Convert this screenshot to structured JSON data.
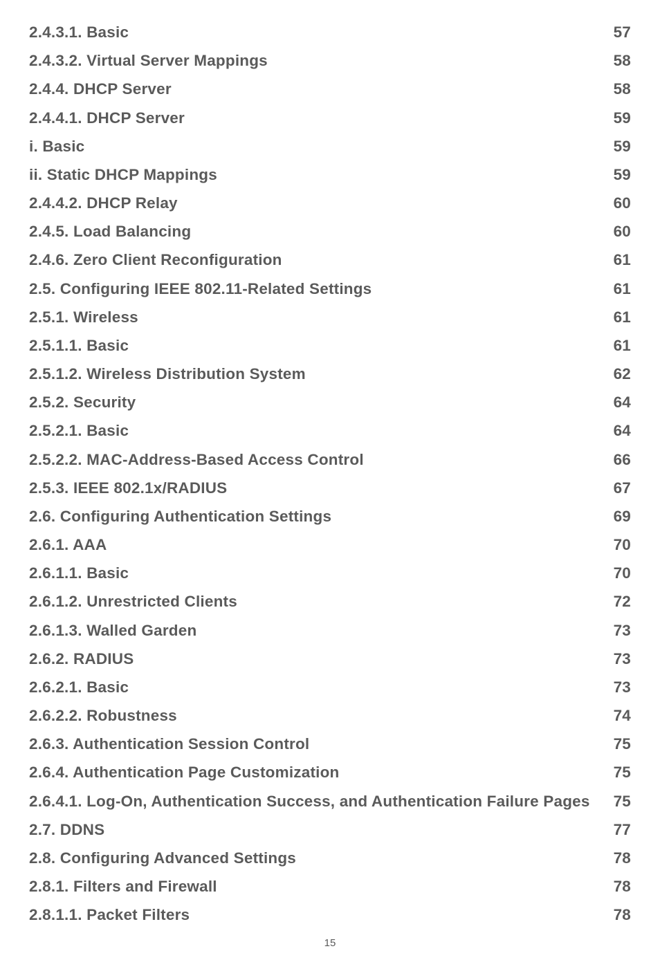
{
  "toc": [
    {
      "title": "2.4.3.1. Basic",
      "page": "57"
    },
    {
      "title": "2.4.3.2. Virtual Server Mappings",
      "page": "58"
    },
    {
      "title": "2.4.4. DHCP Server",
      "page": "58"
    },
    {
      "title": "2.4.4.1. DHCP Server",
      "page": "59"
    },
    {
      "title": "i.  Basic",
      "page": "59"
    },
    {
      "title": "ii. Static DHCP Mappings",
      "page": "59"
    },
    {
      "title": "2.4.4.2. DHCP Relay",
      "page": "60"
    },
    {
      "title": "2.4.5. Load Balancing",
      "page": "60"
    },
    {
      "title": "2.4.6. Zero Client Reconfiguration",
      "page": "61"
    },
    {
      "title": "2.5. Configuring IEEE 802.11-Related Settings",
      "page": "61"
    },
    {
      "title": "2.5.1. Wireless",
      "page": "61"
    },
    {
      "title": "2.5.1.1. Basic",
      "page": "61"
    },
    {
      "title": "2.5.1.2. Wireless Distribution System",
      "page": "62"
    },
    {
      "title": "2.5.2. Security",
      "page": "64"
    },
    {
      "title": "2.5.2.1. Basic",
      "page": "64"
    },
    {
      "title": "2.5.2.2. MAC-Address-Based Access Control",
      "page": "66"
    },
    {
      "title": "2.5.3. IEEE 802.1x/RADIUS",
      "page": "67"
    },
    {
      "title": "2.6. Configuring Authentication Settings",
      "page": "69"
    },
    {
      "title": "2.6.1. AAA",
      "page": "70"
    },
    {
      "title": "2.6.1.1. Basic",
      "page": "70"
    },
    {
      "title": "2.6.1.2. Unrestricted Clients",
      "page": "72"
    },
    {
      "title": "2.6.1.3. Walled Garden",
      "page": "73"
    },
    {
      "title": "2.6.2. RADIUS",
      "page": "73"
    },
    {
      "title": "2.6.2.1. Basic",
      "page": "73"
    },
    {
      "title": "2.6.2.2. Robustness",
      "page": "74"
    },
    {
      "title": "2.6.3. Authentication Session Control",
      "page": "75"
    },
    {
      "title": "2.6.4. Authentication Page Customization",
      "page": "75"
    },
    {
      "title": "2.6.4.1. Log-On, Authentication Success, and Authentication Failure Pages",
      "page": "75"
    },
    {
      "title": "2.7. DDNS",
      "page": "77"
    },
    {
      "title": "2.8. Configuring Advanced Settings",
      "page": "78"
    },
    {
      "title": "2.8.1. Filters and Firewall",
      "page": "78"
    },
    {
      "title": "2.8.1.1. Packet Filters",
      "page": "78"
    }
  ],
  "pageNumber": "15"
}
